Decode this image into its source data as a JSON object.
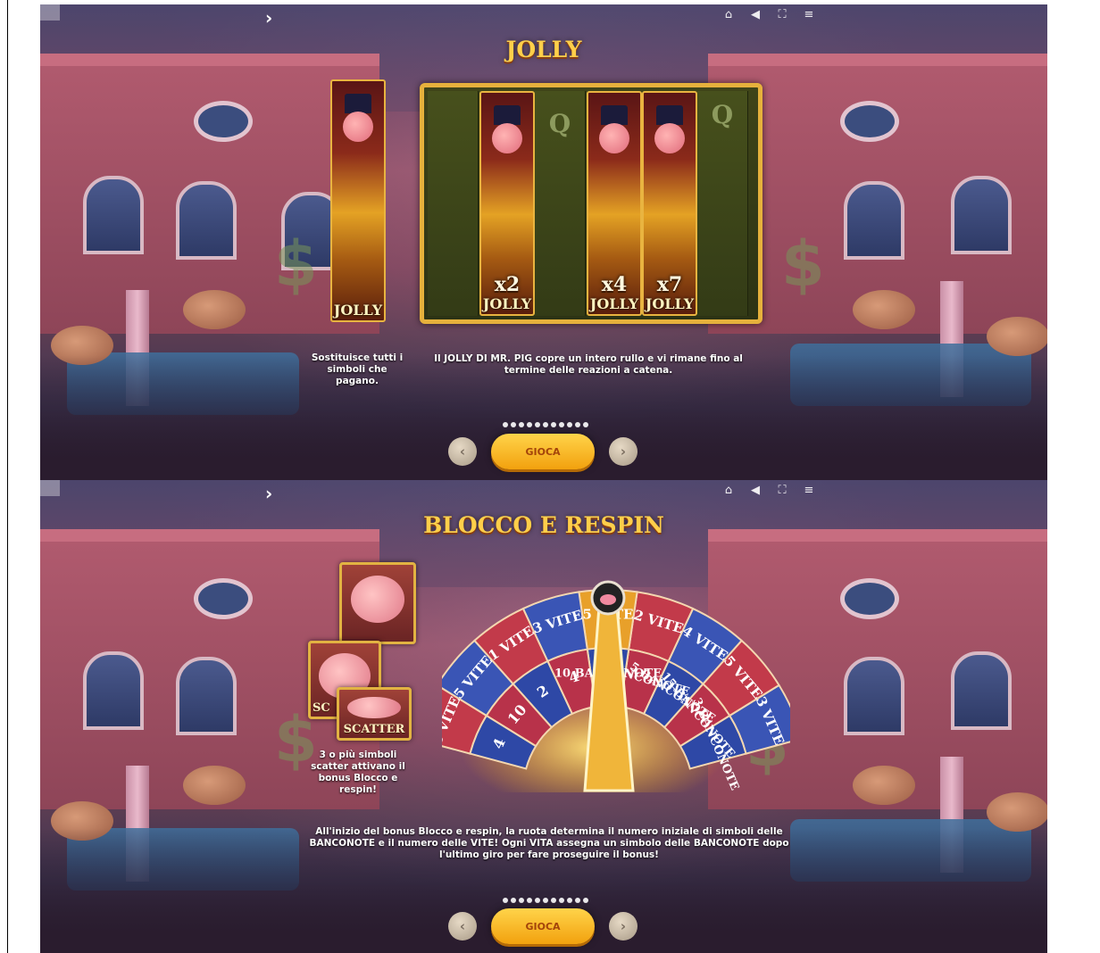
{
  "panels": [
    {
      "title": "JOLLY",
      "top_icons": [
        "home-icon",
        "speaker-icon",
        "fullscreen-icon",
        "menu-icon"
      ],
      "back_glyph": "›",
      "reel_jolly_label": "JOLLY",
      "reel_multipliers": [
        "x2",
        "x4",
        "x7"
      ],
      "reel_symbols": [
        "Q",
        "Q"
      ],
      "caption_left": "Sostituisce tutti i simboli che pagano.",
      "caption_center": "Il JOLLY DI MR. PIG copre un intero rullo e vi rimane fino al termine delle reazioni a catena.",
      "play_label": "GIOCA",
      "prev_glyph": "‹",
      "next_glyph": "›"
    },
    {
      "title": "BLOCCO E RESPIN",
      "top_icons": [
        "home-icon",
        "speaker-icon",
        "fullscreen-icon",
        "menu-icon"
      ],
      "back_glyph": "›",
      "scatter_label": "SCATTER",
      "scatter_partial": "SC",
      "caption_left": "3 o più simboli scatter attivano il bonus Blocco e respin!",
      "caption_bottom": "All'inizio del bonus Blocco e respin, la ruota determina il numero iniziale di simboli delle BANCONOTE e il numero delle VITE! Ogni VITA assegna un simbolo delle BANCONOTE dopo l'ultimo giro per fare proseguire il bonus!",
      "play_label": "GIOCA",
      "prev_glyph": "‹",
      "next_glyph": "›",
      "wheel": {
        "outer": [
          {
            "value": "3",
            "label": "VITE",
            "color": "#3a55b5"
          },
          {
            "value": "5",
            "label": "VITE",
            "color": "#c23a4a"
          },
          {
            "value": "4",
            "label": "VITE",
            "color": "#3a55b5"
          },
          {
            "value": "2",
            "label": "VITE",
            "color": "#c23a4a"
          },
          {
            "value": "5",
            "label": "VITE",
            "color": "#e8a02a"
          },
          {
            "value": "3",
            "label": "VITE",
            "color": "#3a55b5"
          },
          {
            "value": "1",
            "label": "VITE",
            "color": "#c23a4a"
          },
          {
            "value": "5",
            "label": "VITE",
            "color": "#3a55b5"
          },
          {
            "value": "3",
            "label": "VITE",
            "color": "#c23a4a"
          }
        ],
        "inner": [
          {
            "value": "3",
            "label": "BANCONOTE"
          },
          {
            "value": "15",
            "label": "BANCONOTE"
          },
          {
            "value": "5",
            "label": "BANCONOTE"
          },
          {
            "value": "2",
            "label": "BANCONOTE"
          },
          {
            "value": "10",
            "label": "BANCONOTE"
          },
          {
            "value": "4",
            "label": ""
          },
          {
            "value": "2",
            "label": ""
          },
          {
            "value": "10",
            "label": ""
          },
          {
            "value": "4",
            "label": ""
          }
        ]
      }
    }
  ]
}
